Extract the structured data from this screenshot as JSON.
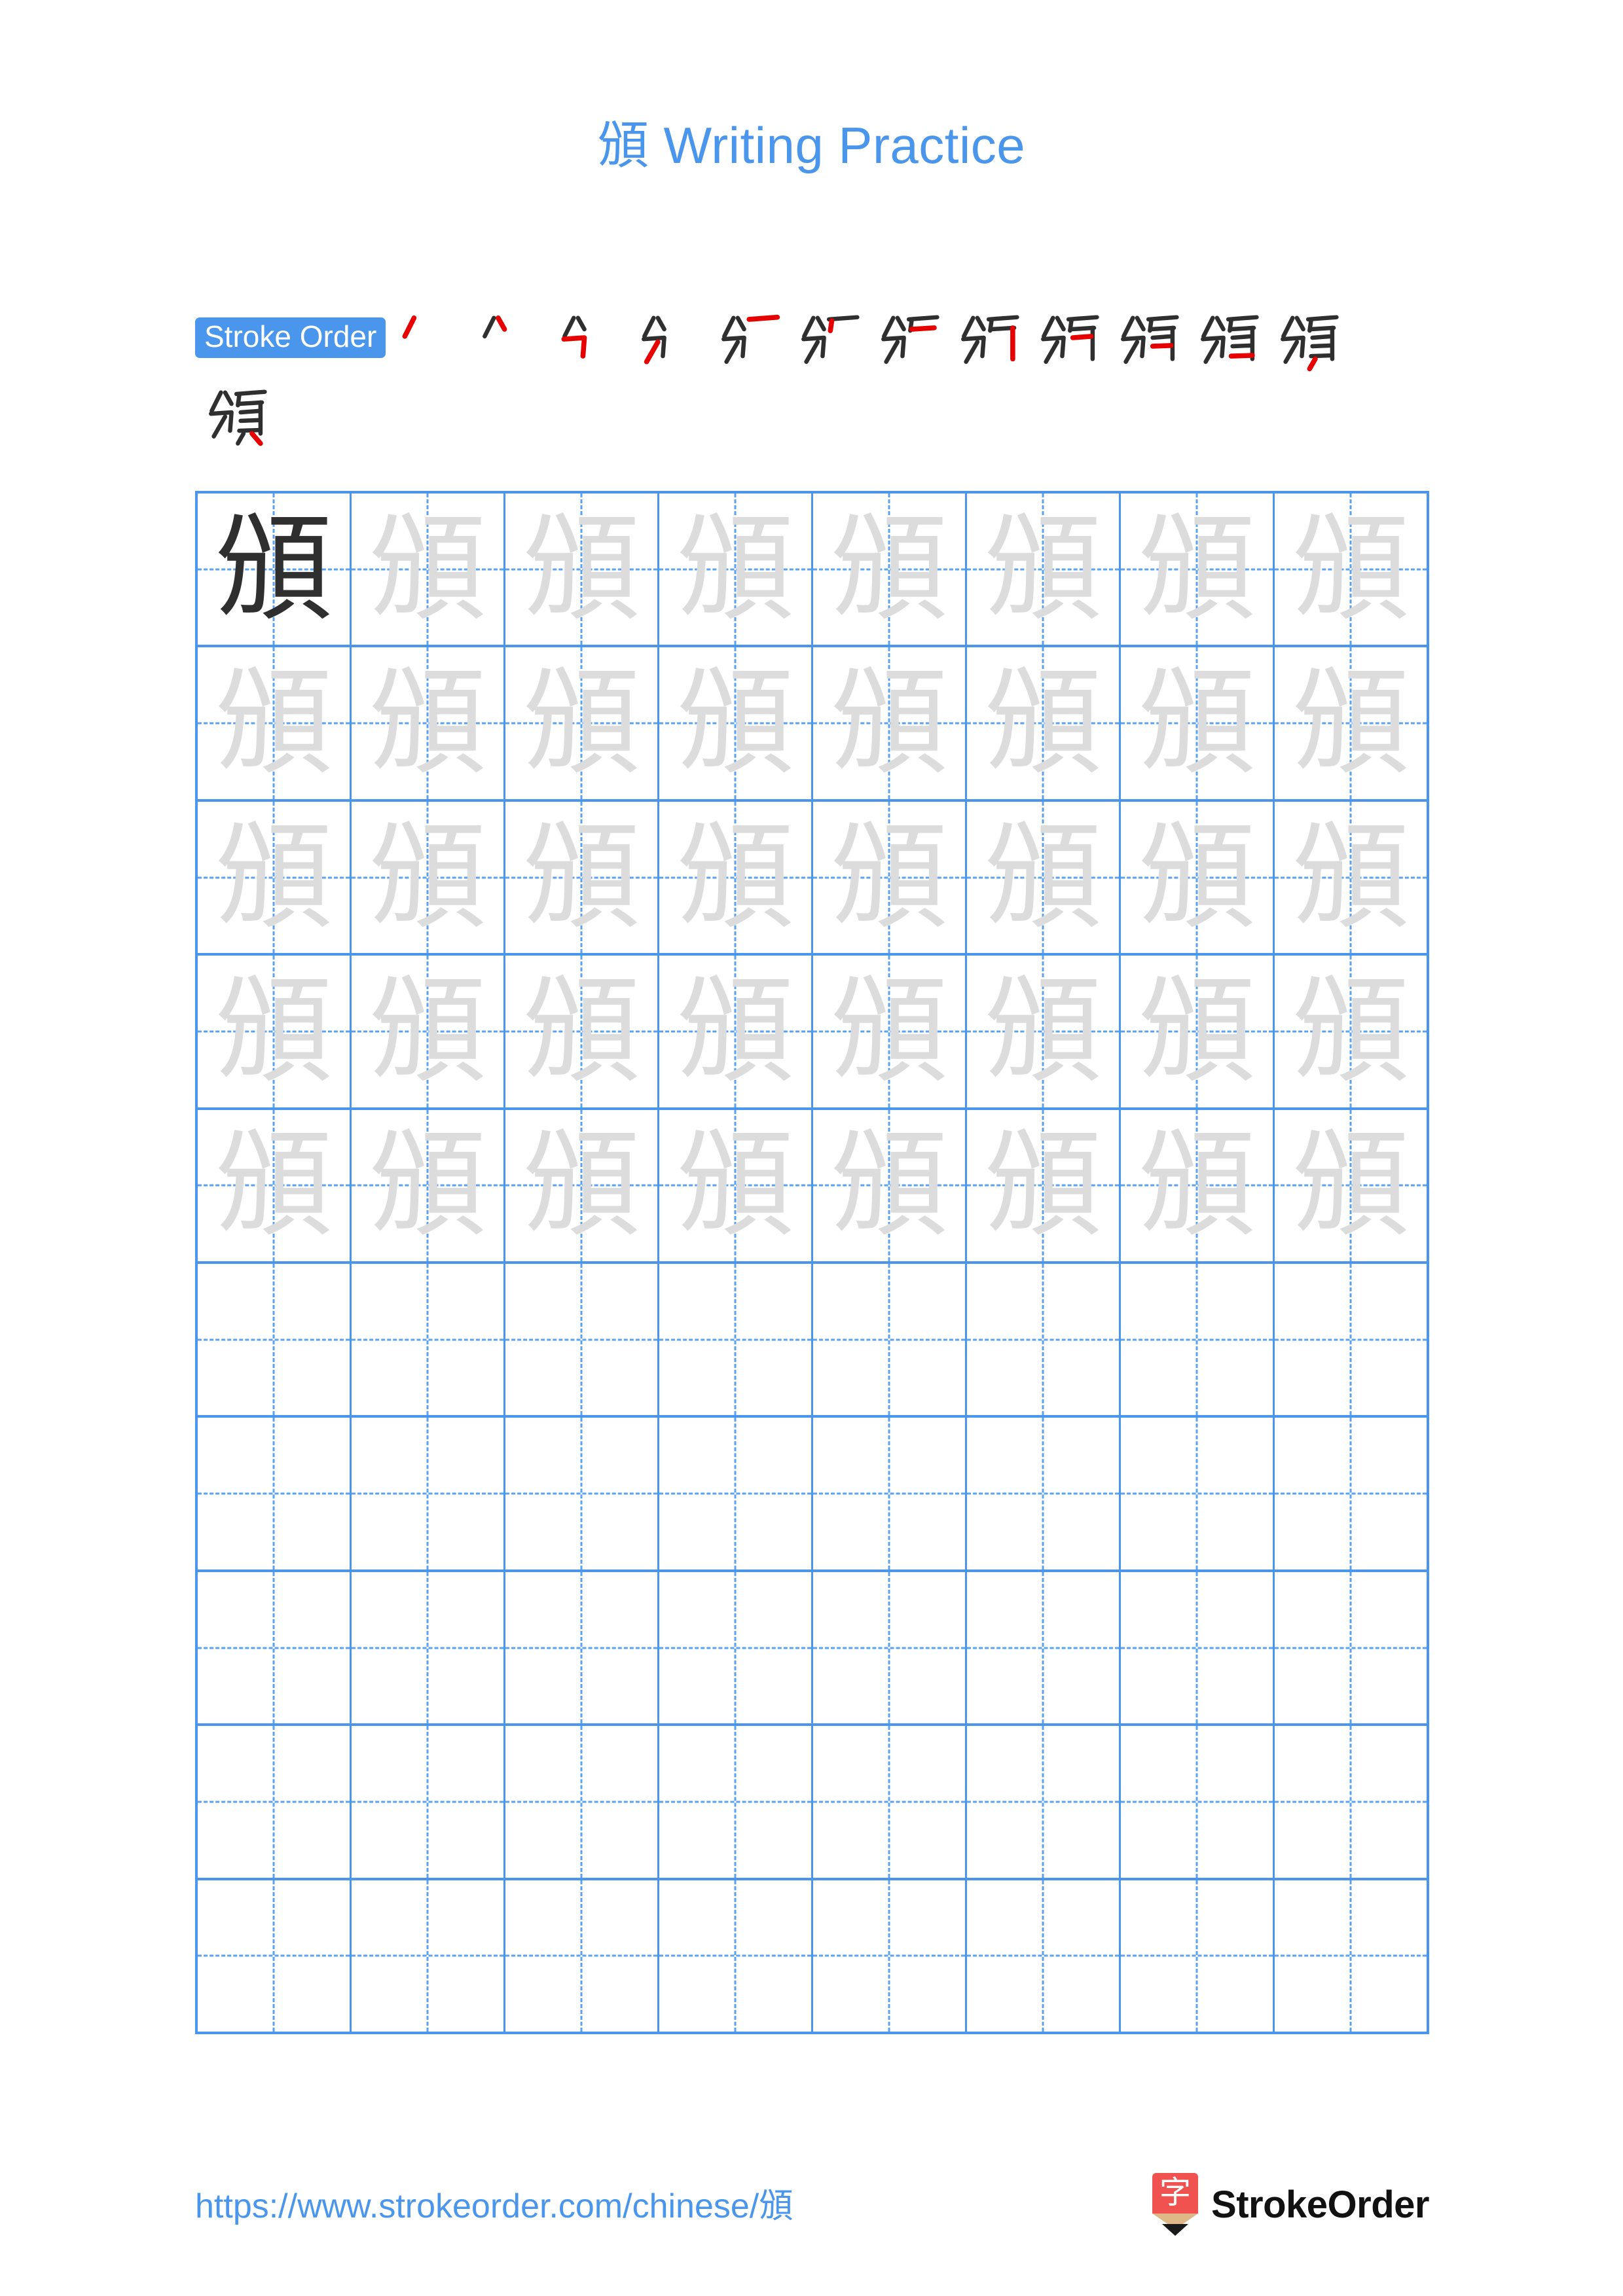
{
  "character": "頒",
  "title": {
    "hanzi": "頒",
    "text": " Writing Practice",
    "color": "#4a96ec"
  },
  "stroke_order": {
    "label": "Stroke Order",
    "label_bg": "#4a96ec",
    "label_color": "#ffffff",
    "total_strokes": 13,
    "stroke_color": "#2f2f2f",
    "highlight_color": "#e60000",
    "steps_row1": 12,
    "steps_row2": 1,
    "steps": [
      {
        "index": 1,
        "partial": "丿"
      },
      {
        "index": 2,
        "partial": "八"
      },
      {
        "index": 3,
        "partial": "分"
      },
      {
        "index": 4,
        "partial": "分"
      },
      {
        "index": 5,
        "partial": "分一"
      },
      {
        "index": 6,
        "partial": "分厂"
      },
      {
        "index": 7,
        "partial": "分厂"
      },
      {
        "index": 8,
        "partial": "頒"
      },
      {
        "index": 9,
        "partial": "頒"
      },
      {
        "index": 10,
        "partial": "頒"
      },
      {
        "index": 11,
        "partial": "頒"
      },
      {
        "index": 12,
        "partial": "頒"
      },
      {
        "index": 13,
        "partial": "頒"
      }
    ]
  },
  "grid": {
    "columns": 8,
    "rows": 10,
    "line_color": "#4a96ec",
    "guide_color": "#5ba3ee",
    "model_char_color": "#2f2f2f",
    "ghost_char_color": "#dcdcdc",
    "rows_data": [
      {
        "row": 1,
        "cells": [
          "model",
          "ghost",
          "ghost",
          "ghost",
          "ghost",
          "ghost",
          "ghost",
          "ghost"
        ]
      },
      {
        "row": 2,
        "cells": [
          "ghost",
          "ghost",
          "ghost",
          "ghost",
          "ghost",
          "ghost",
          "ghost",
          "ghost"
        ]
      },
      {
        "row": 3,
        "cells": [
          "ghost",
          "ghost",
          "ghost",
          "ghost",
          "ghost",
          "ghost",
          "ghost",
          "ghost"
        ]
      },
      {
        "row": 4,
        "cells": [
          "ghost",
          "ghost",
          "ghost",
          "ghost",
          "ghost",
          "ghost",
          "ghost",
          "ghost"
        ]
      },
      {
        "row": 5,
        "cells": [
          "ghost",
          "ghost",
          "ghost",
          "ghost",
          "ghost",
          "ghost",
          "ghost",
          "ghost"
        ]
      },
      {
        "row": 6,
        "cells": [
          "empty",
          "empty",
          "empty",
          "empty",
          "empty",
          "empty",
          "empty",
          "empty"
        ]
      },
      {
        "row": 7,
        "cells": [
          "empty",
          "empty",
          "empty",
          "empty",
          "empty",
          "empty",
          "empty",
          "empty"
        ]
      },
      {
        "row": 8,
        "cells": [
          "empty",
          "empty",
          "empty",
          "empty",
          "empty",
          "empty",
          "empty",
          "empty"
        ]
      },
      {
        "row": 9,
        "cells": [
          "empty",
          "empty",
          "empty",
          "empty",
          "empty",
          "empty",
          "empty",
          "empty"
        ]
      },
      {
        "row": 10,
        "cells": [
          "empty",
          "empty",
          "empty",
          "empty",
          "empty",
          "empty",
          "empty",
          "empty"
        ]
      }
    ]
  },
  "footer": {
    "url": "https://www.strokeorder.com/chinese/頒",
    "url_color": "#4a96ec",
    "brand_name": "StrokeOrder",
    "logo_char": "字",
    "logo_body_color": "#f0534f",
    "logo_wood_color": "#deb887",
    "logo_tip_color": "#1a1a1a"
  }
}
